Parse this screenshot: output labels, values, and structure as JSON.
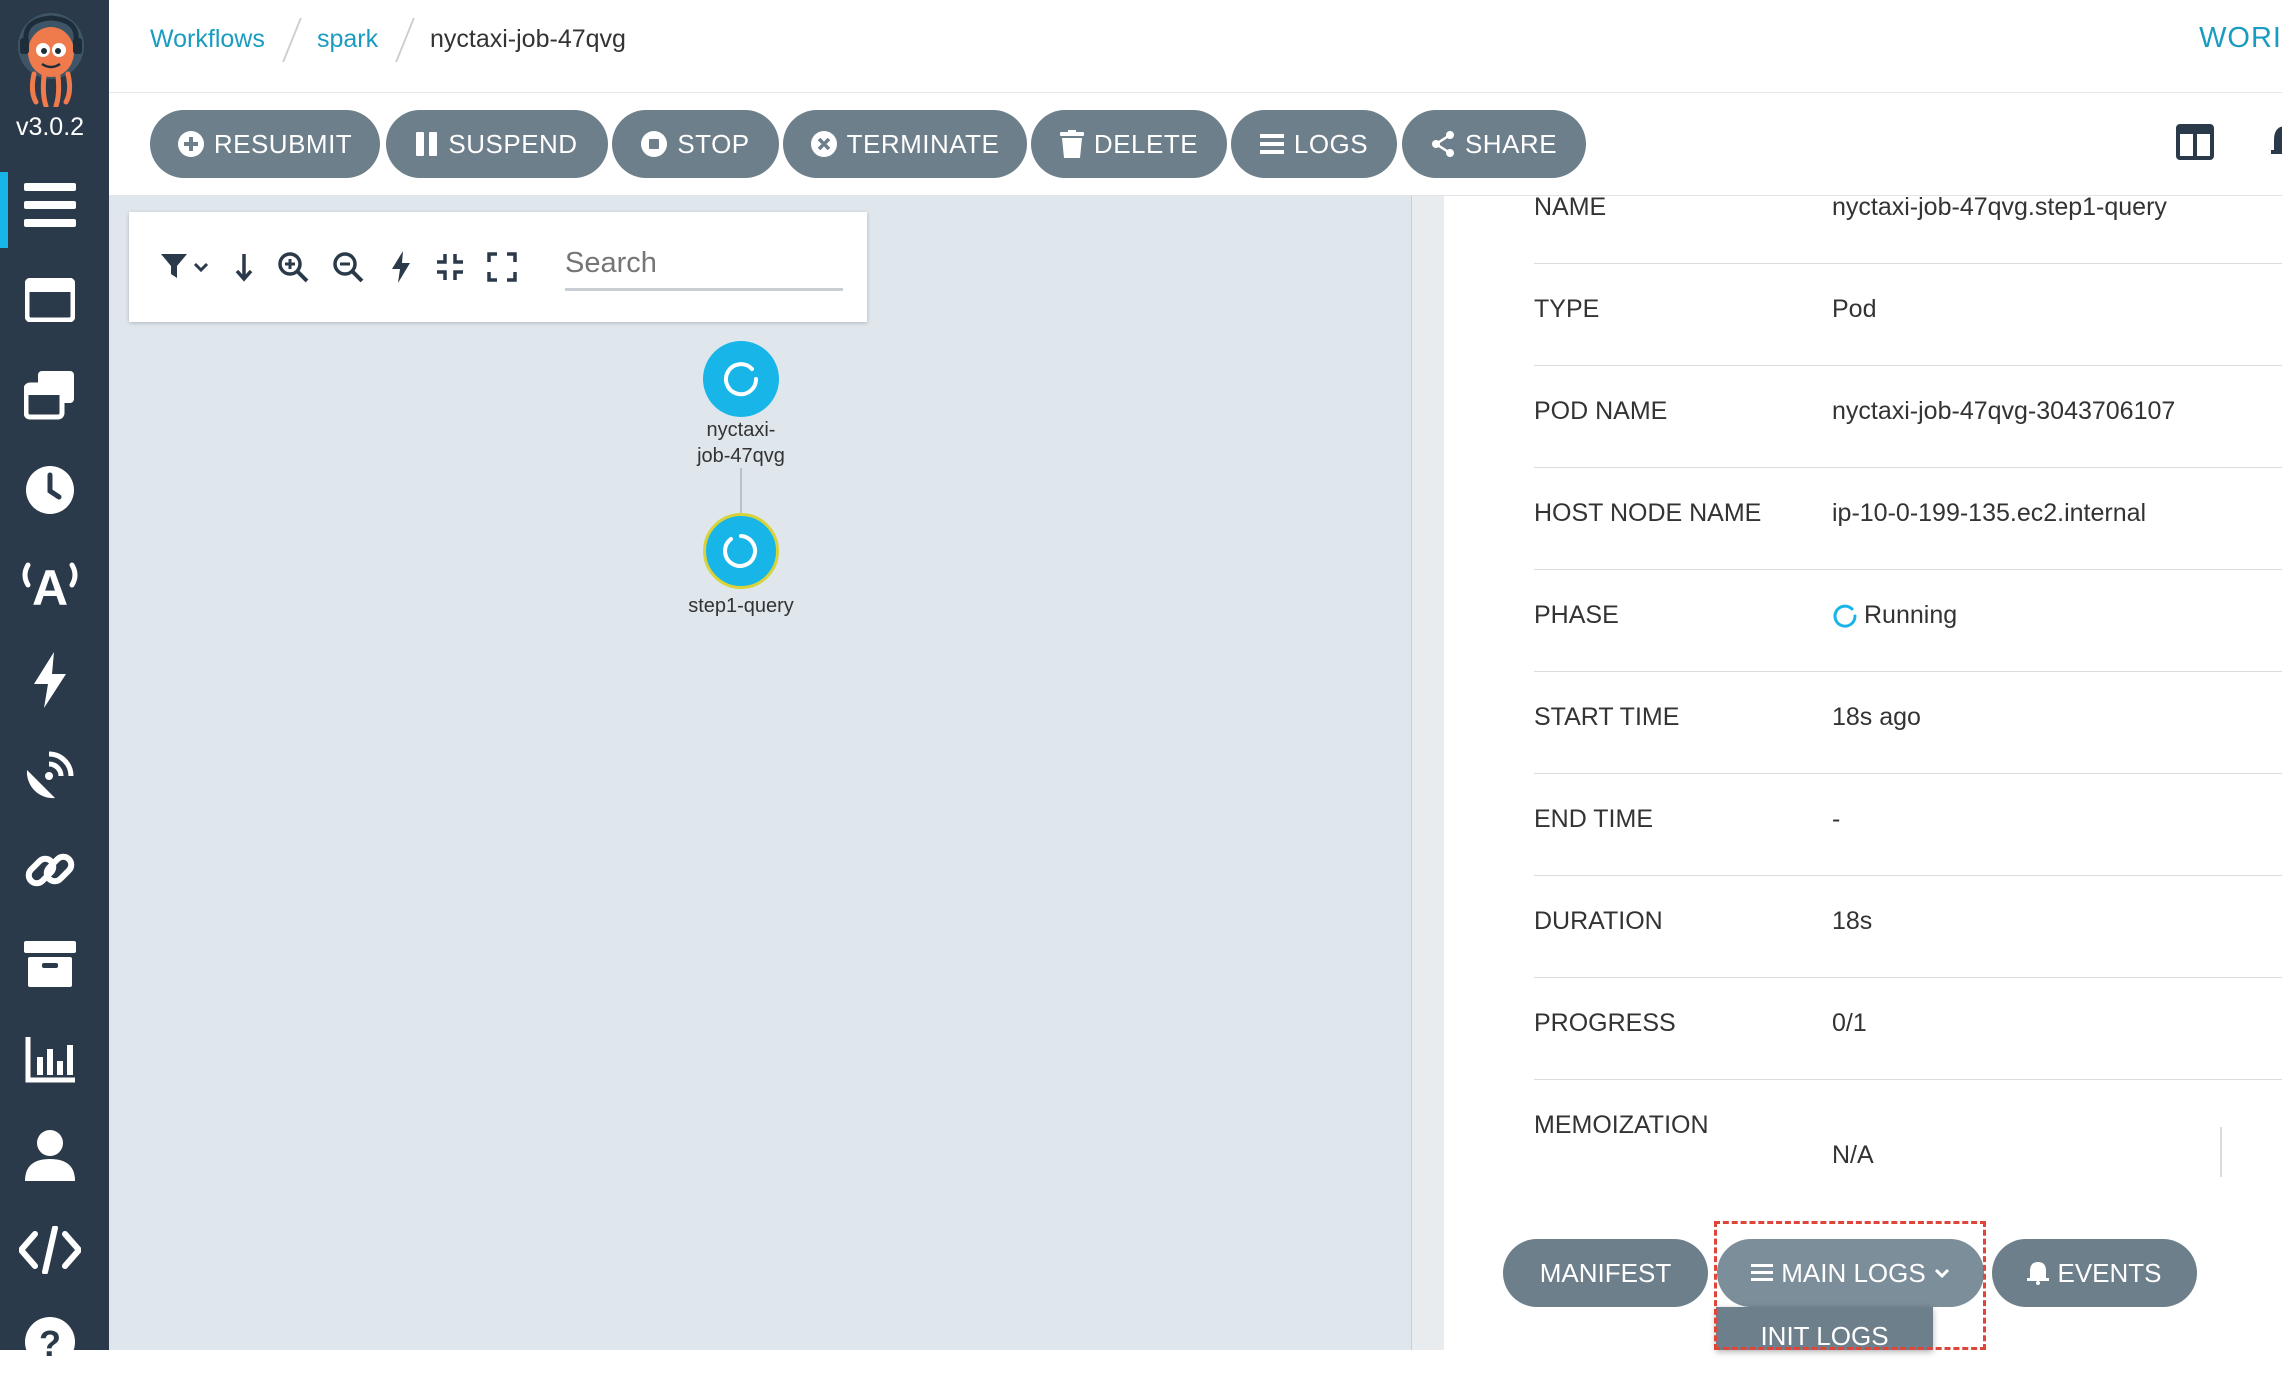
{
  "app": {
    "version": "v3.0.2"
  },
  "sidebar": {
    "items": [
      {
        "icon": "workflows-icon",
        "active": true
      },
      {
        "icon": "workflow-templates-icon"
      },
      {
        "icon": "cluster-workflow-templates-icon"
      },
      {
        "icon": "cron-workflows-icon"
      },
      {
        "icon": "event-sources-icon"
      },
      {
        "icon": "sensors-icon"
      },
      {
        "icon": "event-flow-icon"
      },
      {
        "icon": "link-icon"
      },
      {
        "icon": "archive-icon"
      },
      {
        "icon": "reports-icon"
      },
      {
        "icon": "user-icon"
      },
      {
        "icon": "api-docs-icon"
      },
      {
        "icon": "help-icon"
      }
    ]
  },
  "breadcrumb": {
    "items": [
      "Workflows",
      "spark",
      "nyctaxi-job-47qvg"
    ]
  },
  "header": {
    "right_label": "WORI"
  },
  "toolbar": {
    "buttons": [
      "RESUBMIT",
      "SUSPEND",
      "STOP",
      "TERMINATE",
      "DELETE",
      "LOGS",
      "SHARE"
    ]
  },
  "graph": {
    "search_placeholder": "Search",
    "nodes": [
      {
        "label_line1": "nyctaxi-",
        "label_line2": "job-47qvg"
      },
      {
        "label_line1": "step1-query"
      }
    ]
  },
  "details": {
    "rows": [
      {
        "key": "NAME",
        "value": "nyctaxi-job-47qvg.step1-query"
      },
      {
        "key": "TYPE",
        "value": "Pod"
      },
      {
        "key": "POD NAME",
        "value": "nyctaxi-job-47qvg-3043706107"
      },
      {
        "key": "HOST NODE NAME",
        "value": "ip-10-0-199-135.ec2.internal"
      },
      {
        "key": "PHASE",
        "value": "Running"
      },
      {
        "key": "START TIME",
        "value": "18s ago"
      },
      {
        "key": "END TIME",
        "value": "-"
      },
      {
        "key": "DURATION",
        "value": "18s"
      },
      {
        "key": "PROGRESS",
        "value": "0/1"
      },
      {
        "key": "MEMOIZATION",
        "value": "N/A"
      }
    ]
  },
  "bottom_buttons": {
    "manifest": "MANIFEST",
    "main_logs": "MAIN LOGS",
    "events": "EVENTS",
    "dropdown_item": "INIT LOGS"
  },
  "colors": {
    "sidebar_bg": "#2b3a4a",
    "accent": "#18b5e8",
    "button_bg": "#6d7f8b",
    "link": "#1a9cc0",
    "highlight": "#e0453a"
  }
}
